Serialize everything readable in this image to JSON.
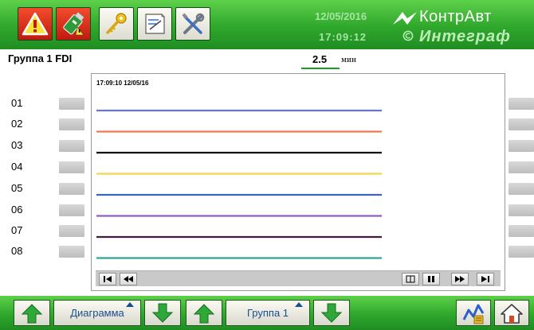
{
  "header": {
    "date": "12/05/2016",
    "time": "17:09:12",
    "brand_primary": "КонтрАвт",
    "brand_secondary": "Интеграф",
    "toolbar_icons": [
      "warning-icon",
      "usb-icon",
      "key-icon",
      "notepad-icon",
      "tools-icon"
    ]
  },
  "group": {
    "title": "Группа 1 FDI",
    "interval_value": "2.5",
    "interval_unit": "мин"
  },
  "chart": {
    "timestamp": "17:09:10  12/05/16",
    "channels": [
      {
        "label": "01",
        "color": "#6b74cc"
      },
      {
        "label": "02",
        "color": "#f27a4f"
      },
      {
        "label": "03",
        "color": "#111111"
      },
      {
        "label": "04",
        "color": "#f2d64a"
      },
      {
        "label": "05",
        "color": "#3f62c4"
      },
      {
        "label": "06",
        "color": "#8b62c2"
      },
      {
        "label": "07",
        "color": "#3b1f3c"
      },
      {
        "label": "08",
        "color": "#2ea59b"
      }
    ],
    "controls": [
      "jump-start-icon",
      "rewind-icon",
      "window-icon",
      "pause-icon",
      "fast-forward-icon",
      "jump-end-icon"
    ]
  },
  "footer": {
    "mode_label": "Диаграмма",
    "group_label": "Группа 1"
  },
  "colors": {
    "accent_green": "#2fa72c",
    "button_face": "#f5f5ec",
    "label_blue": "#1a4d8f"
  }
}
